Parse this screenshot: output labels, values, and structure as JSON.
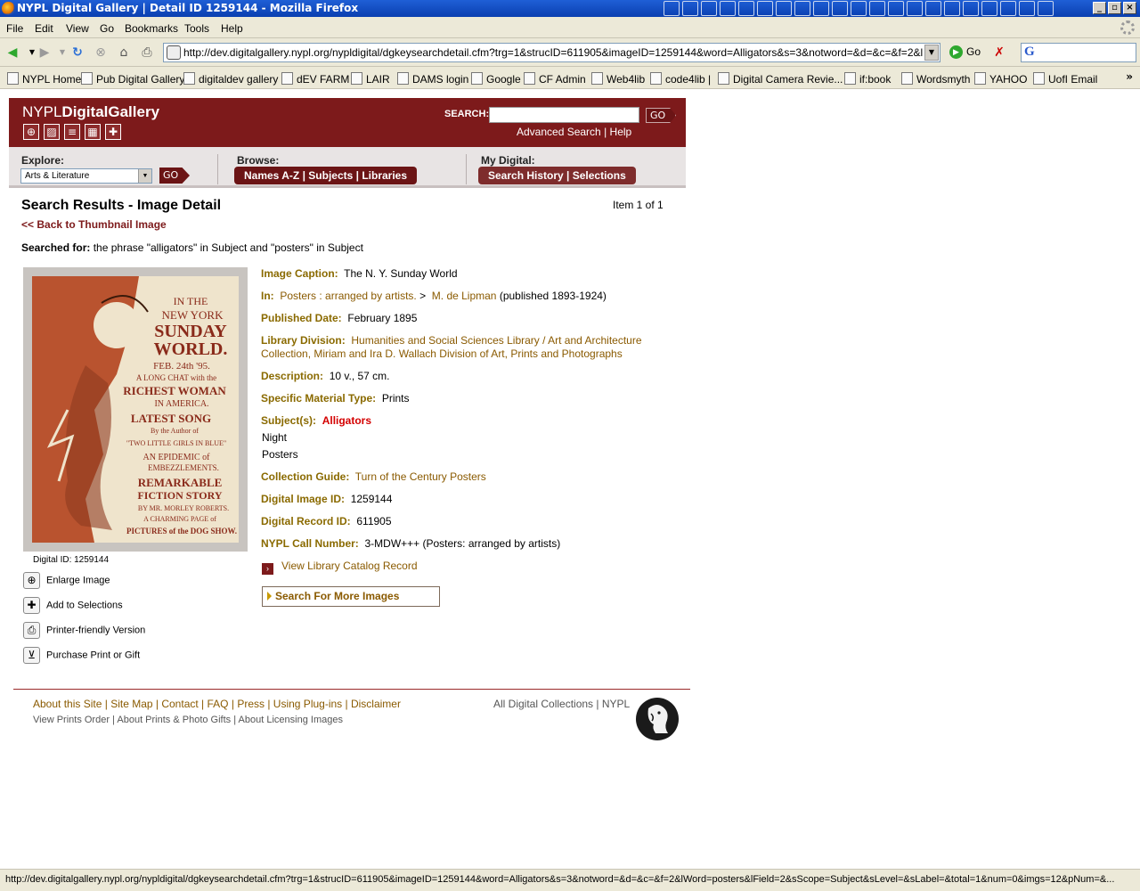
{
  "window": {
    "title": "NYPL Digital Gallery | Detail ID 1259144 - Mozilla Firefox"
  },
  "menu": [
    "File",
    "Edit",
    "View",
    "Go",
    "Bookmarks",
    "Tools",
    "Help"
  ],
  "nav": {
    "url": "http://dev.digitalgallery.nypl.org/nypldigital/dgkeysearchdetail.cfm?trg=1&strucID=611905&imageID=1259144&word=Alligators&s=3&notword=&d=&c=&f=2&lWord=pos",
    "go_label": "Go",
    "search_engine_letter": "G"
  },
  "bookmarks": [
    "NYPL Home",
    "Pub Digital Gallery",
    "digitaldev gallery",
    "dEV FARM",
    "LAIR",
    "DAMS login",
    "Google",
    "CF Admin",
    "Web4lib",
    "code4lib |",
    "Digital Camera Revie...",
    "if:book",
    "Wordsmyth",
    "YAHOO",
    "UofI Email"
  ],
  "header": {
    "logo_light": "NYPL",
    "logo_bold": "DigitalGallery",
    "search_label": "SEARCH:",
    "search_value": "",
    "go_label": "GO",
    "advanced_search": "Advanced Search",
    "help": "Help"
  },
  "toolbar": {
    "explore_label": "Explore:",
    "explore_selected": "Arts & Literature",
    "explore_go": "GO",
    "browse_label": "Browse:",
    "names": "Names A-Z",
    "subjects": "Subjects",
    "libraries": "Libraries",
    "mydigital_label": "My Digital:",
    "search_history": "Search History",
    "selections": "Selections"
  },
  "results": {
    "title": "Search Results - Image Detail",
    "item_count": "Item 1 of 1",
    "back_link": "<< Back to Thumbnail Image",
    "searched_label": "Searched for:",
    "searched_text": "the phrase \"alligators\" in Subject and \"posters\" in Subject"
  },
  "poster": {
    "line1": "IN THE",
    "line2": "NEW YORK",
    "line3": "SUNDAY",
    "line4": "WORLD.",
    "line5": "FEB. 24th '95.",
    "line6": "A LONG CHAT with the",
    "line7": "RICHEST WOMAN",
    "line8": "IN AMERICA.",
    "line9": "LATEST SONG",
    "line10": "By the Author of",
    "line11": "\"TWO LITTLE GIRLS IN BLUE\"",
    "line12": "AN EPIDEMIC of",
    "line13": "EMBEZZLEMENTS.",
    "line14": "REMARKABLE",
    "line15": "FICTION STORY",
    "line16": "BY MR. MORLEY ROBERTS.",
    "line17": "A CHARMING PAGE of",
    "line18": "PICTURES of the DOG SHOW."
  },
  "thumbnail": {
    "digital_id_caption": "Digital ID: 1259144"
  },
  "actions": {
    "enlarge": "Enlarge Image",
    "add_selection": "Add to Selections",
    "printer": "Printer-friendly Version",
    "purchase": "Purchase Print or Gift"
  },
  "details": {
    "caption_label": "Image Caption:",
    "caption_value": "The N. Y. Sunday World",
    "in_label": "In:",
    "in_link1": "Posters : arranged by artists.",
    "in_sep": ">",
    "in_link2": "M. de Lipman",
    "in_tail": "(published 1893-1924)",
    "date_label": "Published Date:",
    "date_value": "February 1895",
    "division_label": "Library Division:",
    "division_line1": "Humanities and Social Sciences Library / Art and Architecture",
    "division_line2": "Collection, Miriam and Ira D. Wallach Division of Art, Prints and Photographs",
    "description_label": "Description:",
    "description_value": "10 v., 57 cm.",
    "material_label": "Specific Material Type:",
    "material_value": "Prints",
    "subjects_label": "Subject(s):",
    "subject1": "Alligators",
    "subject2": "Night",
    "subject3": "Posters",
    "guide_label": "Collection Guide:",
    "guide_value": "Turn of the Century Posters",
    "image_id_label": "Digital Image ID:",
    "image_id_value": "1259144",
    "record_id_label": "Digital Record ID:",
    "record_id_value": "611905",
    "call_label": "NYPL Call Number:",
    "call_value": "3-MDW+++ (Posters: arranged by artists)",
    "catalog_link": "View Library Catalog Record",
    "more_images": "Search For More Images"
  },
  "footer": {
    "about": "About this Site",
    "sitemap": "Site Map",
    "contact": "Contact",
    "faq": "FAQ",
    "press": "Press",
    "plugins": "Using Plug-ins",
    "disclaimer": "Disclaimer",
    "view_prints": "View Prints Order",
    "about_prints": "About Prints & Photo Gifts",
    "about_licensing": "About Licensing Images",
    "all_collections": "All Digital Collections",
    "nypl": "NYPL"
  },
  "status": {
    "text": "http://dev.digitalgallery.nypl.org/nypldigital/dgkeysearchdetail.cfm?trg=1&strucID=611905&imageID=1259144&word=Alligators&s=3&notword=&d=&c=&f=2&lWord=posters&lField=2&sScope=Subject&sLevel=&sLabel=&total=1&num=0&imgs=12&pNum=&..."
  }
}
